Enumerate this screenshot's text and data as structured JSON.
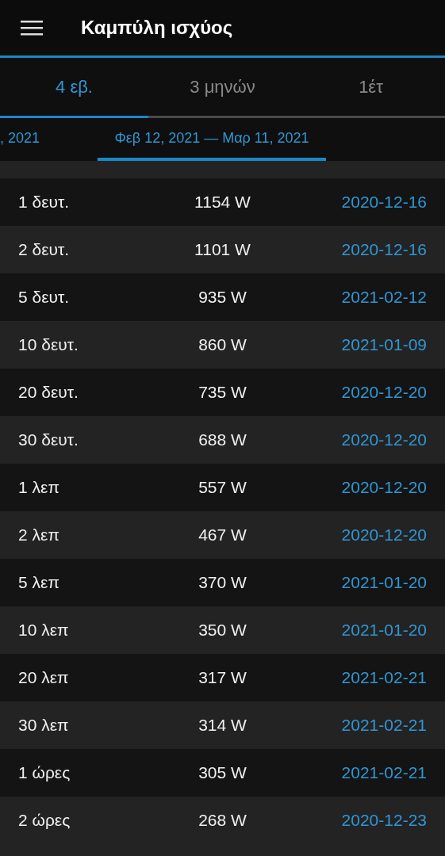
{
  "app_bar": {
    "title": "Καμπύλη ισχύος"
  },
  "tabs": [
    {
      "label": "4 εβ.",
      "selected": true
    },
    {
      "label": "3 μηνών",
      "selected": false
    },
    {
      "label": "1έτ",
      "selected": false
    }
  ],
  "periods": [
    {
      "label": ", 2021",
      "selected": false
    },
    {
      "label": "Φεβ 12, 2021 — Μαρ 11, 2021",
      "selected": true
    }
  ],
  "table": {
    "rows": [
      {
        "duration": "1 δευτ.",
        "power": "1154 W",
        "date": "2020-12-16"
      },
      {
        "duration": "2 δευτ.",
        "power": "1101 W",
        "date": "2020-12-16"
      },
      {
        "duration": "5 δευτ.",
        "power": "935 W",
        "date": "2021-02-12"
      },
      {
        "duration": "10 δευτ.",
        "power": "860 W",
        "date": "2021-01-09"
      },
      {
        "duration": "20 δευτ.",
        "power": "735 W",
        "date": "2020-12-20"
      },
      {
        "duration": "30 δευτ.",
        "power": "688 W",
        "date": "2020-12-20"
      },
      {
        "duration": "1 λεπ",
        "power": "557 W",
        "date": "2020-12-20"
      },
      {
        "duration": "2 λεπ",
        "power": "467 W",
        "date": "2020-12-20"
      },
      {
        "duration": "5 λεπ",
        "power": "370 W",
        "date": "2021-01-20"
      },
      {
        "duration": "10 λεπ",
        "power": "350 W",
        "date": "2021-01-20"
      },
      {
        "duration": "20 λεπ",
        "power": "317 W",
        "date": "2021-02-21"
      },
      {
        "duration": "30 λεπ",
        "power": "314 W",
        "date": "2021-02-21"
      },
      {
        "duration": "1 ώρες",
        "power": "305 W",
        "date": "2021-02-21"
      },
      {
        "duration": "2 ώρες",
        "power": "268 W",
        "date": "2020-12-23"
      }
    ]
  }
}
